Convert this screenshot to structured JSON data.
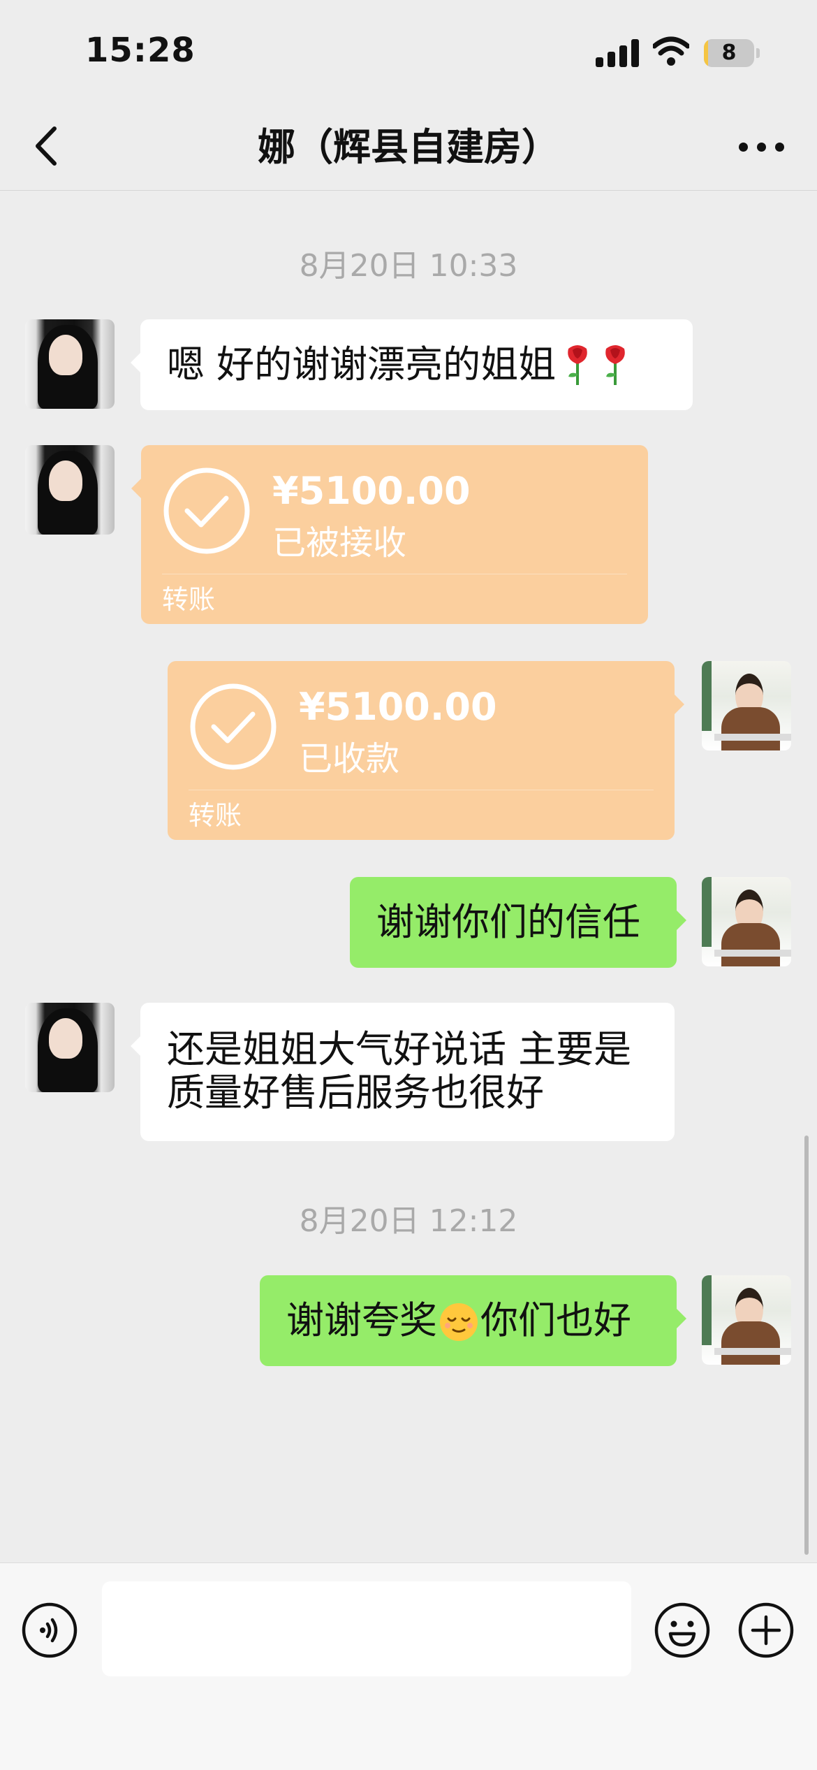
{
  "status_bar": {
    "time": "15:28",
    "battery": "8",
    "battery_level": 0.08
  },
  "nav": {
    "title": "娜（辉县自建房）"
  },
  "messages": [
    {
      "kind": "timestamp",
      "text": "8月20日 10:33"
    },
    {
      "kind": "text",
      "side": "left",
      "text": "嗯 好的谢谢漂亮的姐姐",
      "emoji": [
        "rose-emoji",
        "rose-emoji"
      ]
    },
    {
      "kind": "transfer",
      "side": "left",
      "amount": "¥5100.00",
      "status": "已被接收",
      "label": "转账"
    },
    {
      "kind": "transfer",
      "side": "right",
      "amount": "¥5100.00",
      "status": "已收款",
      "label": "转账"
    },
    {
      "kind": "text",
      "side": "right",
      "text": "谢谢你们的信任"
    },
    {
      "kind": "text",
      "side": "left",
      "text": "还是姐姐大气好说话 主要是\n质量好售后服务也很好"
    },
    {
      "kind": "timestamp",
      "text": "8月20日 12:12"
    },
    {
      "kind": "text",
      "side": "right",
      "text_before": "谢谢夸奖",
      "emoji": "relieved-face-emoji",
      "text_after": "你们也好"
    }
  ],
  "input": {
    "value": "",
    "placeholder": ""
  },
  "colors": {
    "background": "#ededed",
    "sent_bubble": "#95ec69",
    "received_bubble": "#ffffff",
    "transfer_card": "#fbcf9e",
    "timestamp_text": "#a9a9a9"
  }
}
